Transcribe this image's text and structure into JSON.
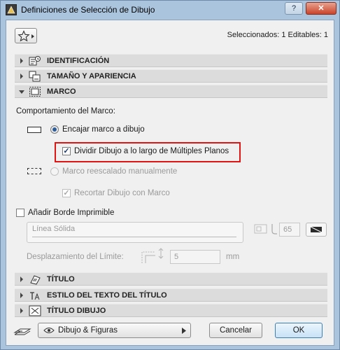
{
  "window": {
    "title": "Definiciones de Selección de Dibujo",
    "help_label": "?",
    "close_label": "✕"
  },
  "header": {
    "favorites_icon": "star-icon",
    "selection_info": "Seleccionados: 1 Editables: 1"
  },
  "sections": [
    {
      "label": "IDENTIFICACIÓN",
      "expanded": false,
      "icon": "id-icon"
    },
    {
      "label": "TAMAÑO Y APARIENCIA",
      "expanded": false,
      "icon": "size-icon"
    },
    {
      "label": "MARCO",
      "expanded": true,
      "icon": "frame-icon"
    },
    {
      "label": "TÍTULO",
      "expanded": false,
      "icon": "title-icon"
    },
    {
      "label": "ESTILO DEL TEXTO DEL TÍTULO",
      "expanded": false,
      "icon": "text-style-icon"
    },
    {
      "label": "TÍTULO DIBUJO",
      "expanded": false,
      "icon": "drawing-title-icon"
    }
  ],
  "marco": {
    "behavior_label": "Comportamiento del Marco:",
    "fit_label": "Encajar marco a dibujo",
    "fit_selected": true,
    "split_label": "Dividir Dibujo a lo largo de Múltiples Planos",
    "split_checked": true,
    "manual_label": "Marco reescalado manualmente",
    "manual_selected": false,
    "crop_label": "Recortar Dibujo con Marco",
    "crop_checked": true,
    "border_label": "Añadir Borde Imprimible",
    "border_checked": false,
    "line_type": "Línea Sólida",
    "pen_number": "65",
    "offset_label": "Desplazamiento del Límite:",
    "offset_value": "5",
    "offset_unit": "mm"
  },
  "footer": {
    "layer_combo": "Dibujo & Figuras",
    "cancel_label": "Cancelar",
    "ok_label": "OK"
  },
  "colors": {
    "title_bar": "#aac4de",
    "highlight_border": "#e11414",
    "section_bar": "#dcdcdc"
  }
}
